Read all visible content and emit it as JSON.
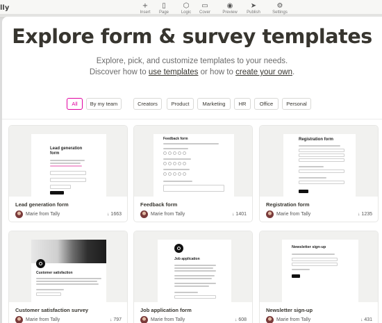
{
  "app": {
    "brand": "lly",
    "toolbar": [
      {
        "label": "Insert",
        "icon": "plus-icon",
        "glyph": "+"
      },
      {
        "label": "Page",
        "icon": "page-icon",
        "glyph": "▯"
      },
      {
        "label": "Logic",
        "icon": "logic-icon",
        "glyph": "⬡"
      },
      {
        "label": "Cover",
        "icon": "cover-icon",
        "glyph": "▭"
      },
      {
        "label": "Preview",
        "icon": "eye-icon",
        "glyph": "◉"
      },
      {
        "label": "Publish",
        "icon": "send-icon",
        "glyph": "➤"
      },
      {
        "label": "Settings",
        "icon": "gear-icon",
        "glyph": "⚙"
      }
    ]
  },
  "modal": {
    "title": "Explore form & survey templates",
    "subtitle1": "Explore, pick, and customize templates to your needs.",
    "subtitle2_pre": "Discover how to ",
    "subtitle2_link1": "use templates",
    "subtitle2_mid": " or how to ",
    "subtitle2_link2": "create your own",
    "subtitle2_post": ".",
    "filters": [
      "All",
      "By my team",
      "Creators",
      "Product",
      "Marketing",
      "HR",
      "Office",
      "Personal"
    ],
    "active_filter": "All",
    "accent": "#e000a0"
  },
  "cards": [
    {
      "title": "Lead generation form",
      "author": "Marie from Tally",
      "uses": "1663",
      "doc_heading": "Lead generation form",
      "doc_text": "Welcome! We'd love to hear what you think about our latest product."
    },
    {
      "title": "Feedback form",
      "author": "Marie from Tally",
      "uses": "1401",
      "doc_heading": "Feedback form"
    },
    {
      "title": "Registration form",
      "author": "Marie from Tally",
      "uses": "1235",
      "doc_heading": "Registration form"
    },
    {
      "title": "Customer satisfaction survey",
      "author": "Marie from Tally",
      "uses": "797",
      "doc_heading": "Customer satisfaction"
    },
    {
      "title": "Job application form",
      "author": "Marie from Tally",
      "uses": "608",
      "doc_heading": "Job application"
    },
    {
      "title": "Newsletter sign-up",
      "author": "Marie from Tally",
      "uses": "431",
      "doc_heading": "Newsletter sign-up"
    }
  ]
}
